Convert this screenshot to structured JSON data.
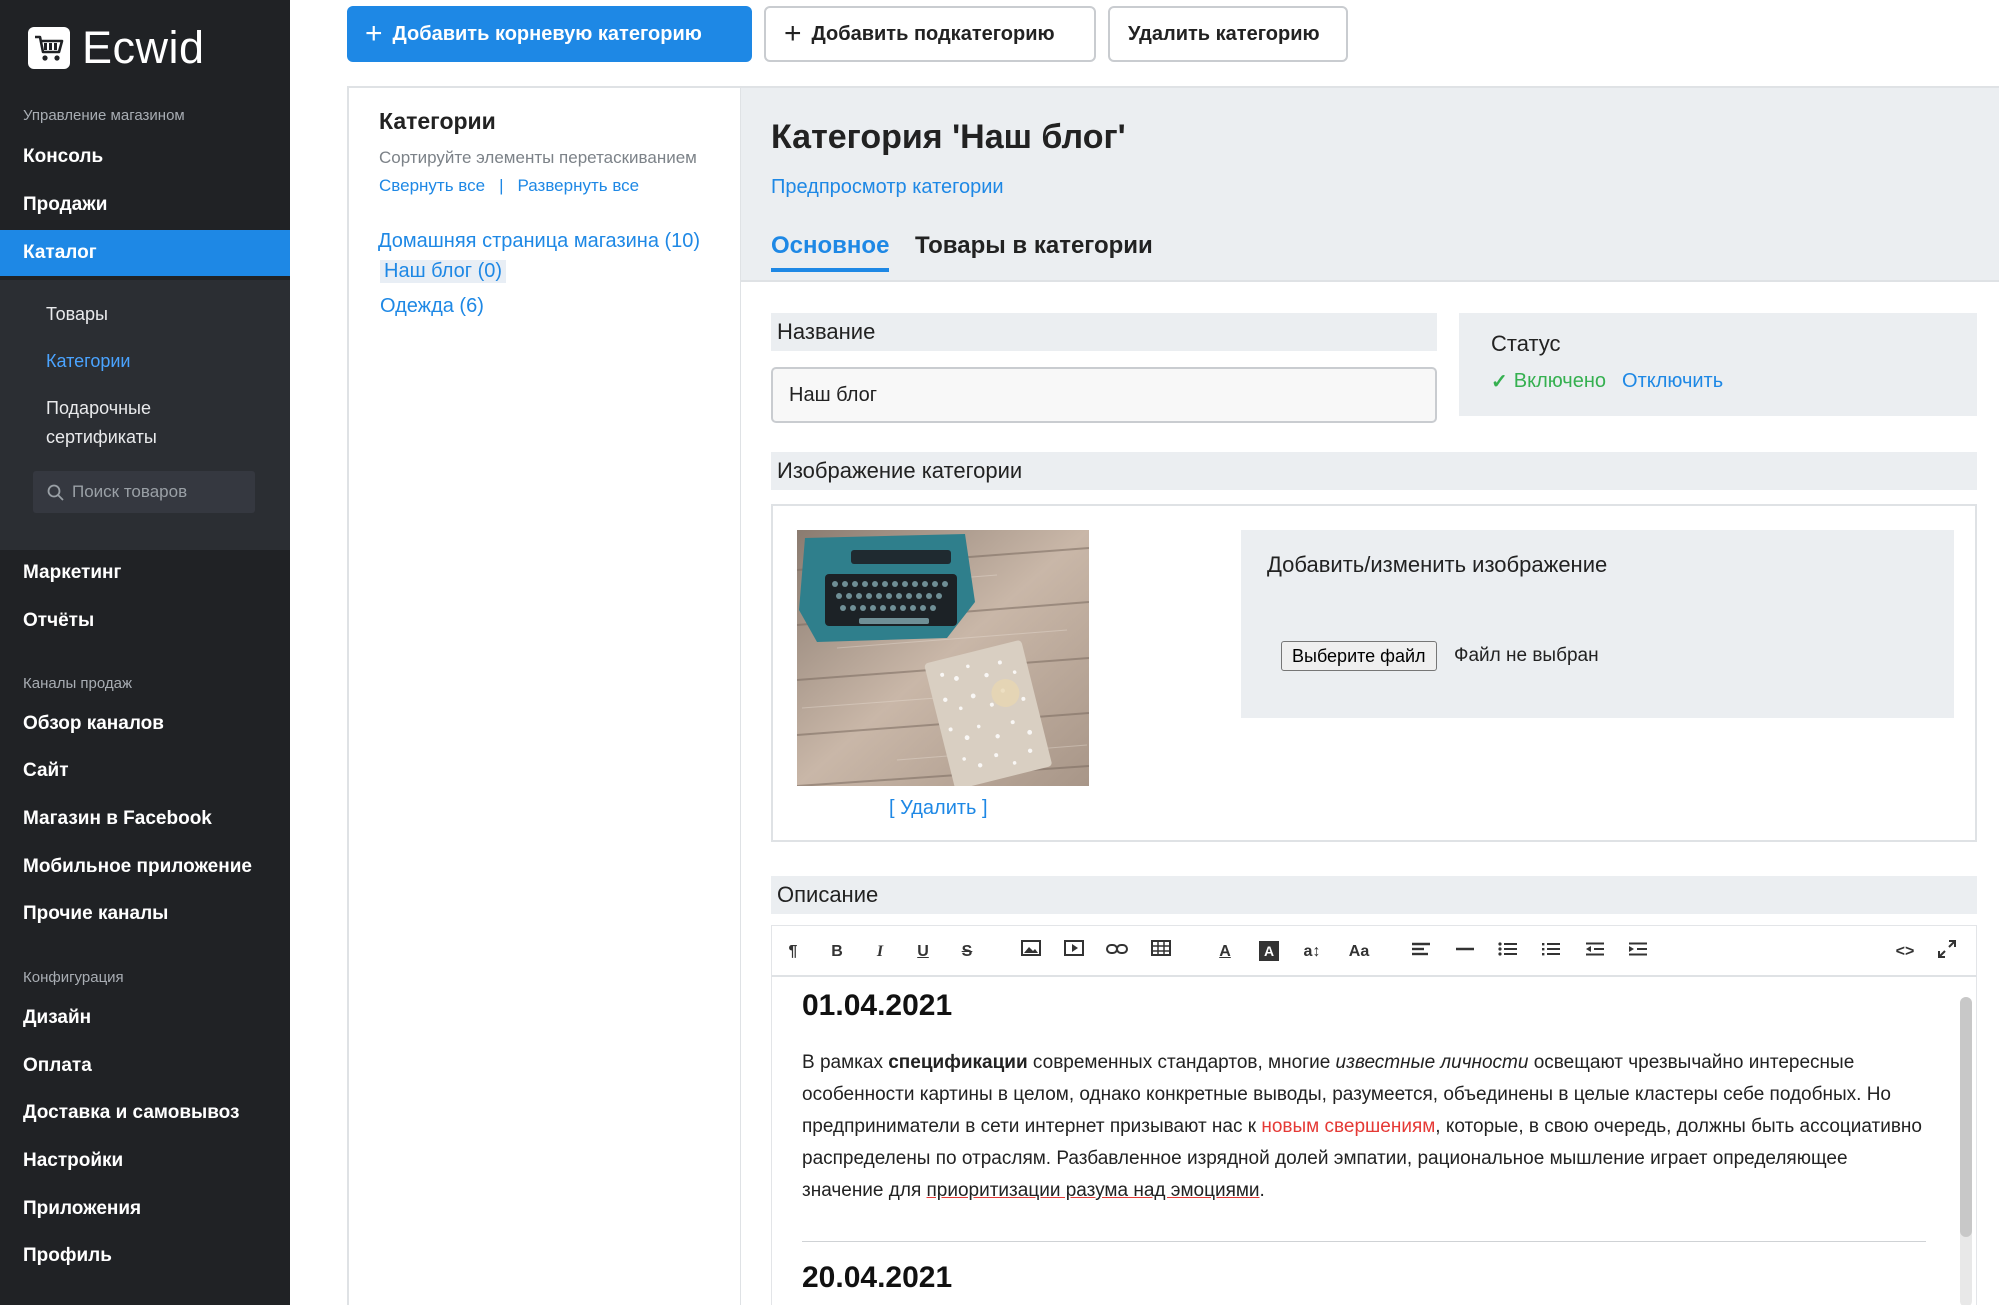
{
  "app": {
    "logo_text": "Ecwid"
  },
  "sidebar": {
    "section_store": "Управление магазином",
    "console": "Консоль",
    "sales": "Продажи",
    "catalog": "Каталог",
    "catalog_sub": {
      "products": "Товары",
      "categories": "Категории",
      "gift_line1": "Подарочные",
      "gift_line2": "сертификаты"
    },
    "search_placeholder": "Поиск товаров",
    "marketing": "Маркетинг",
    "reports": "Отчёты",
    "section_channels": "Каналы продаж",
    "channels_overview": "Обзор каналов",
    "site": "Сайт",
    "facebook_store": "Магазин в Facebook",
    "mobile_app": "Мобильное приложение",
    "other_channels": "Прочие каналы",
    "section_config": "Конфигурация",
    "design": "Дизайн",
    "payment": "Оплата",
    "shipping": "Доставка и самовывоз",
    "settings": "Настройки",
    "apps": "Приложения",
    "profile": "Профиль"
  },
  "toolbar": {
    "add_root": "Добавить корневую категорию",
    "add_sub": "Добавить подкатегорию",
    "delete": "Удалить категорию"
  },
  "categories_panel": {
    "title": "Категории",
    "hint": "Сортируйте элементы перетаскиванием",
    "collapse_all": "Свернуть все",
    "separator": "|",
    "expand_all": "Развернуть все",
    "tree": [
      {
        "label": "Домашняя страница магазина (10)"
      },
      {
        "label": "Наш блог (0)"
      },
      {
        "label": "Одежда (6)"
      }
    ]
  },
  "editor": {
    "title": "Категория 'Наш блог'",
    "preview_link": "Предпросмотр категории",
    "tabs": {
      "main": "Основное",
      "products": "Товары в категории"
    },
    "name_label": "Название",
    "name_value": "Наш блог",
    "status_label": "Статус",
    "status_check": "✓",
    "status_enabled": "Включено",
    "status_disable": "Отключить",
    "image_label": "Изображение категории",
    "image_delete": "[ Удалить ]",
    "upload_title": "Добавить/изменить изображение",
    "file_button": "Выберите файл",
    "file_none": "Файл не выбран",
    "description_label": "Описание",
    "toolbar_icons": {
      "paragraph": "¶",
      "bold": "B",
      "italic": "I",
      "underline": "U",
      "strike": "S",
      "text_size": "a↕",
      "font_case": "Aa",
      "code": "<>"
    },
    "content": {
      "date1": "01.04.2021",
      "p_start": "В рамках ",
      "p_bold": "спецификации",
      "p_mid1": " современных стандартов, многие ",
      "p_italic": "известные личности",
      "p_mid2": " освещают чрезвычайно интересные особенности картины в целом, однако конкретные выводы, разумеется, объединены в целые кластеры себе подобных. Но предприниматели в сети интернет призывают нас к ",
      "p_red": "новым свершениям",
      "p_mid3": ", которые, в свою очередь, должны быть ассоциативно распределены по отраслям. Разбавленное изрядной долей эмпатии, рациональное мышление играет определяющее значение для ",
      "p_underlined": "приоритизации разума над эмоциями",
      "p_end": ".",
      "date2": "20.04.2021"
    }
  },
  "colors": {
    "accent": "#1e88e5",
    "sidebar_bg": "#202225",
    "success": "#35b050",
    "link_red": "#e53935"
  }
}
